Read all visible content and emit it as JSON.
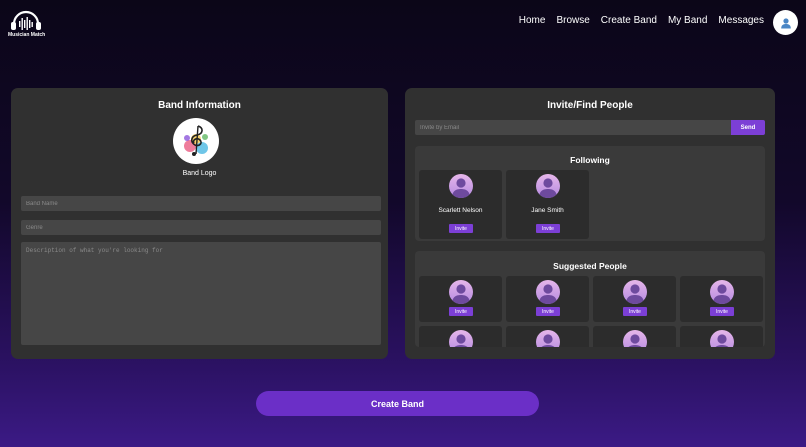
{
  "header": {
    "logo_text": "Musician Match",
    "nav": [
      "Home",
      "Browse",
      "Create Band",
      "My Band",
      "Messages"
    ],
    "avatar_icon": "user-icon"
  },
  "band_info": {
    "title": "Band Information",
    "logo_label": "Band Logo",
    "band_name_placeholder": "Band Name",
    "genre_placeholder": "Genre",
    "description_placeholder": "Description of what you're looking for"
  },
  "invite": {
    "title": "Invite/Find People",
    "email_placeholder": "Invite by Email",
    "send_label": "Send",
    "following": {
      "title": "Following",
      "people": [
        {
          "name": "Scarlett Nelson",
          "invite_label": "Invite"
        },
        {
          "name": "Jane Smith",
          "invite_label": "Invite"
        }
      ]
    },
    "suggested": {
      "title": "Suggested People",
      "invite_label": "Invite"
    }
  },
  "create_band_label": "Create Band",
  "colors": {
    "accent": "#7c3fd6",
    "panel": "#303030",
    "subpanel": "#3a3a3a",
    "card": "#2c2c2c"
  }
}
